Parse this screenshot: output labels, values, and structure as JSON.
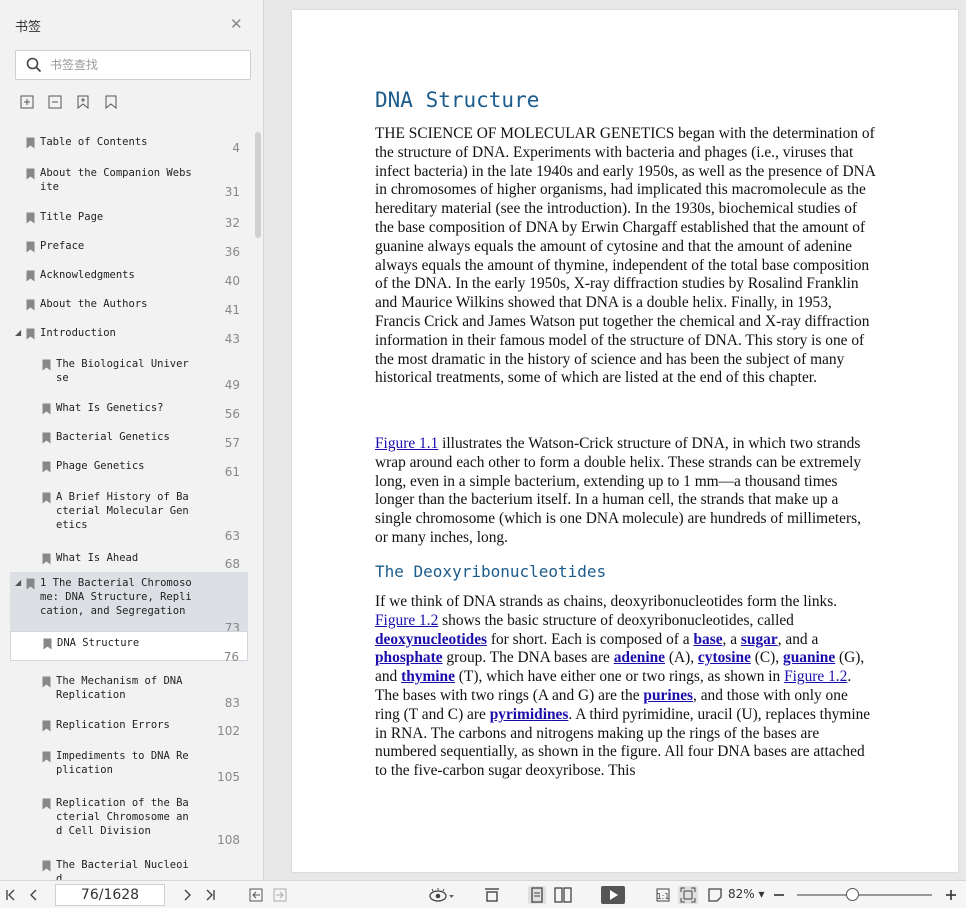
{
  "sidebar": {
    "title": "书签",
    "search_placeholder": "书签查找",
    "bookmarks": [
      {
        "label": "Table of Contents",
        "page": "4"
      },
      {
        "label": "About the Companion Webs\nite",
        "page": "31"
      },
      {
        "label": "Title Page",
        "page": "32"
      },
      {
        "label": "Preface",
        "page": "36"
      },
      {
        "label": "Acknowledgments",
        "page": "40"
      },
      {
        "label": "About the Authors",
        "page": "41"
      },
      {
        "label": "Introduction",
        "page": "43"
      },
      {
        "label": "The Biological Univer\nse",
        "page": "49"
      },
      {
        "label": "What Is Genetics?",
        "page": "56"
      },
      {
        "label": "Bacterial Genetics",
        "page": "57"
      },
      {
        "label": "Phage Genetics",
        "page": "61"
      },
      {
        "label": "A Brief History of Ba\ncterial Molecular Gen\netics",
        "page": "63"
      },
      {
        "label": "What Is Ahead",
        "page": "68"
      },
      {
        "label": "1 The Bacterial Chromoso\nme: DNA Structure, Repli\ncation, and Segregation",
        "page": "73"
      },
      {
        "label": "DNA Structure",
        "page": "76"
      },
      {
        "label": "The Mechanism of DNA\nReplication",
        "page": "83"
      },
      {
        "label": "Replication Errors",
        "page": "102"
      },
      {
        "label": "Impediments to DNA Re\nplication",
        "page": "105"
      },
      {
        "label": "Replication of the Ba\ncterial Chromosome an\nd Cell Division",
        "page": "108"
      },
      {
        "label": "The Bacterial Nucleoi\nd",
        "page": ""
      }
    ]
  },
  "document": {
    "heading": "DNA Structure",
    "p1": "THE SCIENCE OF MOLECULAR GENETICS began with the determination of the structure of DNA. Experiments with bacteria and phages (i.e., viruses that infect bacteria) in the late 1940s and early 1950s, as well as the presence of DNA in chromosomes of higher organisms, had implicated this macromolecule as the hereditary material (see the introduction). In the 1930s, biochemical studies of the base composition of DNA by Erwin Chargaff established that the amount of guanine always equals the amount of cytosine and that the amount of adenine always equals the amount of thymine, independent of the total base composition of the DNA. In the early 1950s, X-ray diffraction studies by Rosalind Franklin and Maurice Wilkins showed that DNA is a double helix. Finally, in 1953, Francis Crick and James Watson put together the chemical and X-ray diffraction information in their famous model of the structure of DNA. This story is one of the most dramatic in the history of science and has been the subject of many historical treatments, some of which are listed at the end of this chapter.",
    "p2": {
      "link1": "Figure 1.1",
      "text1": " illustrates the Watson-Crick structure of DNA, in which two strands wrap around each other to form a double helix. These strands can be extremely long, even in a simple bacterium, extending up to 1 mm—a thousand times longer than the bacterium itself. In a human cell, the strands that make up a single chromosome (which is one DNA molecule) are hundreds of millimeters, or many inches, long."
    },
    "subheading": "The Deoxyribonucleotides",
    "p3": {
      "t1": "If we think of DNA strands as chains, deoxyribonucleotides form the links. ",
      "fig1": "Figure 1.2",
      "t2": " shows the basic structure of deoxyribonucleotides, called ",
      "k1": "deoxynucleotides",
      "t3": " for short. Each is composed of a ",
      "k2": "base",
      "t4": ", a ",
      "k3": "sugar",
      "t5": ", and a ",
      "k4": "phosphate",
      "t6": " group. The DNA bases are ",
      "k5": "adenine",
      "t7": " (A), ",
      "k6": "cytosine",
      "t8": " (C), ",
      "k7": "guanine",
      "t9": " (G), and ",
      "k8": "thymine",
      "t10": " (T), which have either one or two rings, as shown in ",
      "fig2": "Figure 1.2",
      "t11": ". The bases with two rings (A and G) are the ",
      "k9": "purines",
      "t12": ", and those with only one ring (T and C) are ",
      "k10": "pyrimidines",
      "t13": ". A third pyrimidine, uracil (U), replaces thymine in RNA. The carbons and nitrogens making up the rings of the bases are numbered sequentially, as shown in the figure. All four DNA bases are attached to the five-carbon sugar deoxyribose. This"
    }
  },
  "bottombar": {
    "page_indicator": "76/1628",
    "zoom": "82%"
  }
}
